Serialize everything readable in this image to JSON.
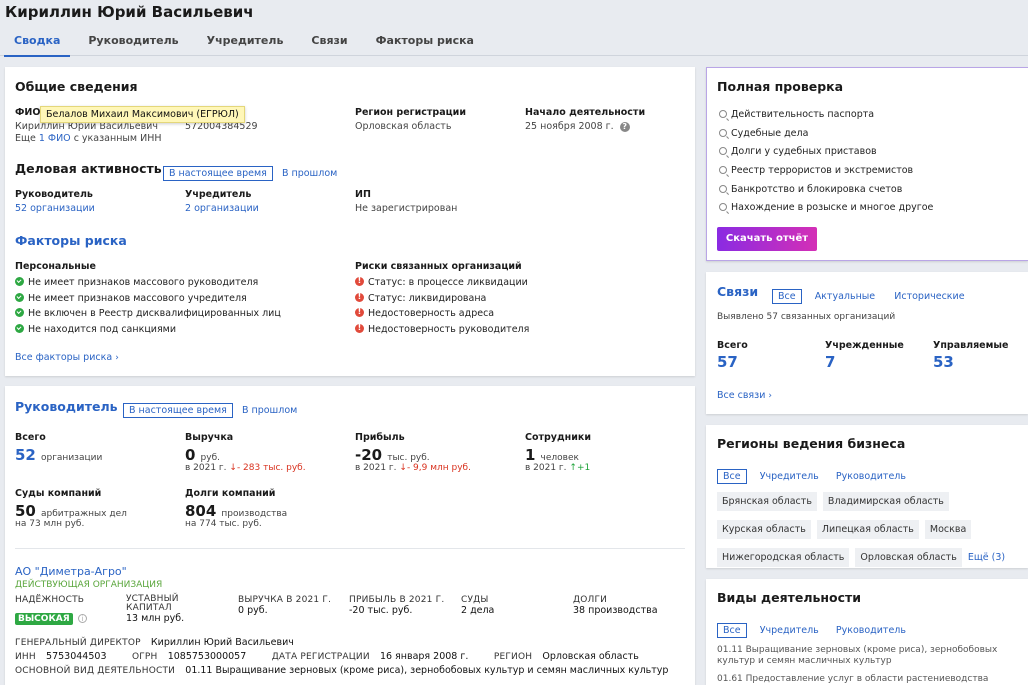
{
  "header": {
    "title": "Кириллин Юрий Васильевич",
    "tabs": [
      "Сводка",
      "Руководитель",
      "Учредитель",
      "Связи",
      "Факторы риска"
    ]
  },
  "general": {
    "title": "Общие сведения",
    "fio_label": "ФИО",
    "fio_value": "Кириллин Юрий Васильевич",
    "fio_more_prefix": "Еще",
    "fio_more_link": "1 ФИО",
    "fio_more_suffix": "с указанным ИНН",
    "inn_partial": "572004384529",
    "tooltip": "Белалов Михаил Максимович (ЕГРЮЛ)",
    "region_label": "Регион регистрации",
    "region_value": "Орловская область",
    "start_label": "Начало деятельности",
    "start_value": "25 ноября 2008 г.",
    "activity_title": "Деловая активность",
    "now_pill": "В настоящее время",
    "past_link": "В прошлом",
    "head_label": "Руководитель",
    "head_value": "52 организации",
    "founder_label": "Учредитель",
    "founder_value": "2 организации",
    "ip_label": "ИП",
    "ip_value": "Не зарегистрирован",
    "risk_title": "Факторы риска",
    "personal_label": "Персональные",
    "personal": [
      "Не имеет признаков массового руководителя",
      "Не имеет признаков массового учредителя",
      "Не включен в Реестр дисквалифицированных лиц",
      "Не находится под санкциями"
    ],
    "related_label": "Риски связанных организаций",
    "related": [
      "Статус: в процессе ликвидации",
      "Статус: ликвидирована",
      "Недостоверность адреса",
      "Недостоверность руководителя"
    ],
    "all_risks": "Все факторы риска"
  },
  "leader": {
    "title": "Руководитель",
    "now_pill": "В настоящее время",
    "past_link": "В прошлом",
    "total_label": "Всего",
    "total_value": "52",
    "total_unit": "организации",
    "rev_label": "Выручка",
    "rev_value": "0",
    "rev_unit": "руб.",
    "rev_year": "в 2021 г.",
    "rev_delta": "- 283 тыс. руб.",
    "profit_label": "Прибыль",
    "profit_value": "-20",
    "profit_unit": "тыс. руб.",
    "profit_year": "в 2021 г.",
    "profit_delta": "- 9,9 млн руб.",
    "emp_label": "Сотрудники",
    "emp_value": "1",
    "emp_unit": "человек",
    "emp_year": "в 2021 г.",
    "emp_delta": "+1",
    "courts_label": "Суды компаний",
    "courts_value": "50",
    "courts_unit": "арбитражных дел",
    "courts_sub": "на 73 млн руб.",
    "debts_label": "Долги компаний",
    "debts_value": "804",
    "debts_unit": "производства",
    "debts_sub": "на 774 тыс. руб."
  },
  "org": {
    "name": "АО \"Диметра-Агро\"",
    "status": "ДЕЙСТВУЮЩАЯ ОРГАНИЗАЦИЯ",
    "reliability_label": "НАДЁЖНОСТЬ",
    "reliability_value": "ВЫСОКАЯ",
    "capital_label_1": "УСТАВНЫЙ",
    "capital_label_2": "КАПИТАЛ",
    "capital_value": "13 млн руб.",
    "revenue_label": "ВЫРУЧКА В 2021 Г.",
    "revenue_value": "0 руб.",
    "profit_label": "ПРИБЫЛЬ В 2021 Г.",
    "profit_value": "-20 тыс. руб.",
    "courts_label": "СУДЫ",
    "courts_value": "2 дела",
    "debts_label": "ДОЛГИ",
    "debts_value": "38 производства",
    "director_label": "ГЕНЕРАЛЬНЫЙ ДИРЕКТОР",
    "director_value": "Кириллин Юрий Васильевич",
    "inn_label": "ИНН",
    "inn_value": "5753044503",
    "ogrn_label": "ОГРН",
    "ogrn_value": "1085753000057",
    "regdate_label": "ДАТА РЕГИСТРАЦИИ",
    "regdate_value": "16 января 2008 г.",
    "region_label": "РЕГИОН",
    "region_value": "Орловская область",
    "okved_label": "ОСНОВНОЙ ВИД ДЕЯТЕЛЬНОСТИ",
    "okved_value": "01.11 Выращивание зерновых (кроме риса), зернобобовых культур и семян масличных культур"
  },
  "check": {
    "title": "Полная проверка",
    "items": [
      "Действительность паспорта",
      "Судебные дела",
      "Долги у судебных приставов",
      "Реестр террористов и экстремистов",
      "Банкротство и блокировка счетов",
      "Нахождение в розыске и многое другое"
    ],
    "button": "Скачать отчёт"
  },
  "links": {
    "title": "Связи",
    "tabs": [
      "Все",
      "Актуальные",
      "Исторические"
    ],
    "found": "Выявлено 57 связанных организаций",
    "total_label": "Всего",
    "total_value": "57",
    "founded_label": "Учрежденные",
    "founded_value": "7",
    "managed_label": "Управляемые",
    "managed_value": "53",
    "all": "Все связи"
  },
  "regions": {
    "title": "Регионы ведения бизнеса",
    "tabs": [
      "Все",
      "Учредитель",
      "Руководитель"
    ],
    "chips": [
      "Брянская область",
      "Владимирская область",
      "Курская область",
      "Липецкая область",
      "Москва",
      "Нижегородская область",
      "Орловская область"
    ],
    "more": "Ещё (3)"
  },
  "kinds": {
    "title": "Виды деятельности",
    "tabs": [
      "Все",
      "Учредитель",
      "Руководитель"
    ],
    "item1": "01.11 Выращивание зерновых (кроме риса), зернобобовых культур и семян масличных культур",
    "item2": "01.61 Предоставление услуг в области растениеводства"
  }
}
